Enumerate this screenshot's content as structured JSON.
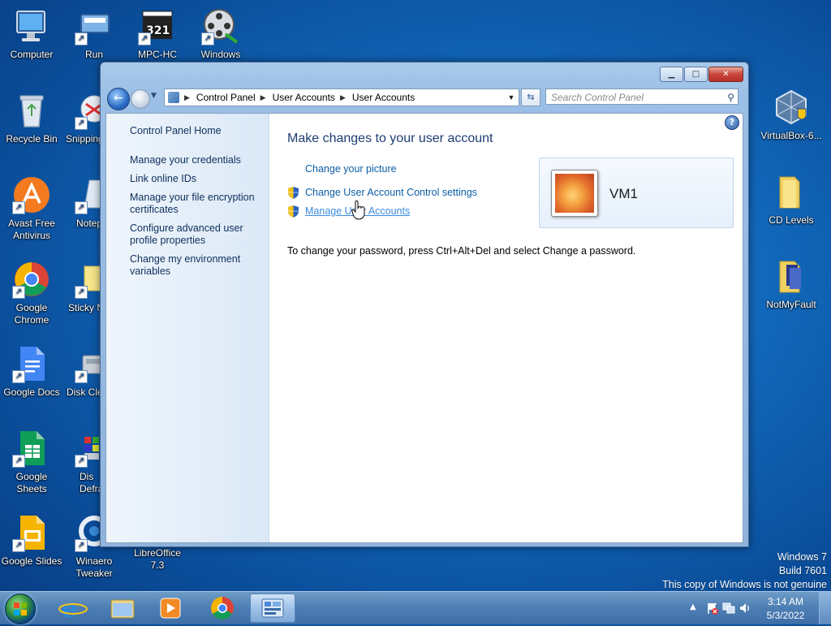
{
  "desktop": {
    "icons_left": [
      {
        "label": "Computer"
      },
      {
        "label": "Recycle Bin"
      },
      {
        "label": "Avast Free Antivirus"
      },
      {
        "label": "Google Chrome"
      },
      {
        "label": "Google Docs"
      },
      {
        "label": "Google Sheets"
      },
      {
        "label": "Google Slides"
      }
    ],
    "icons_col2": [
      {
        "label": "Run"
      },
      {
        "label": "Snipping"
      },
      {
        "label": "Notep"
      },
      {
        "label": "Sticky N"
      },
      {
        "label": "Disk Cle"
      },
      {
        "label": "Dis Defragn"
      },
      {
        "label": "Winaero Tweaker"
      }
    ],
    "icons_top": [
      {
        "label": "MPC-HC"
      },
      {
        "label": "Windows"
      }
    ],
    "icons_bottom": [
      {
        "label": "LibreOffice 7.3"
      }
    ],
    "icons_right": [
      {
        "label": "VirtualBox-6..."
      },
      {
        "label": "CD Levels"
      },
      {
        "label": "NotMyFault"
      }
    ]
  },
  "window": {
    "breadcrumb": [
      "Control Panel",
      "User Accounts",
      "User Accounts"
    ],
    "search_placeholder": "Search Control Panel",
    "help_label": "?",
    "left_pane": {
      "home": "Control Panel Home",
      "links": [
        "Manage your credentials",
        "Link online IDs",
        "Manage your file encryption certificates",
        "Configure advanced user profile properties",
        "Change my environment variables"
      ]
    },
    "main": {
      "title": "Make changes to your user account",
      "tasks": [
        "Change your picture",
        "Change User Account Control settings",
        "Manage User Accounts"
      ],
      "info": "To change your password, press Ctrl+Alt+Del and select Change a password.",
      "user_name": "VM1"
    }
  },
  "watermark": {
    "line1": "Windows 7",
    "line2": "Build 7601",
    "line3": "This copy of Windows is not genuine"
  },
  "taskbar": {
    "time": "3:14 AM",
    "date": "5/3/2022"
  }
}
